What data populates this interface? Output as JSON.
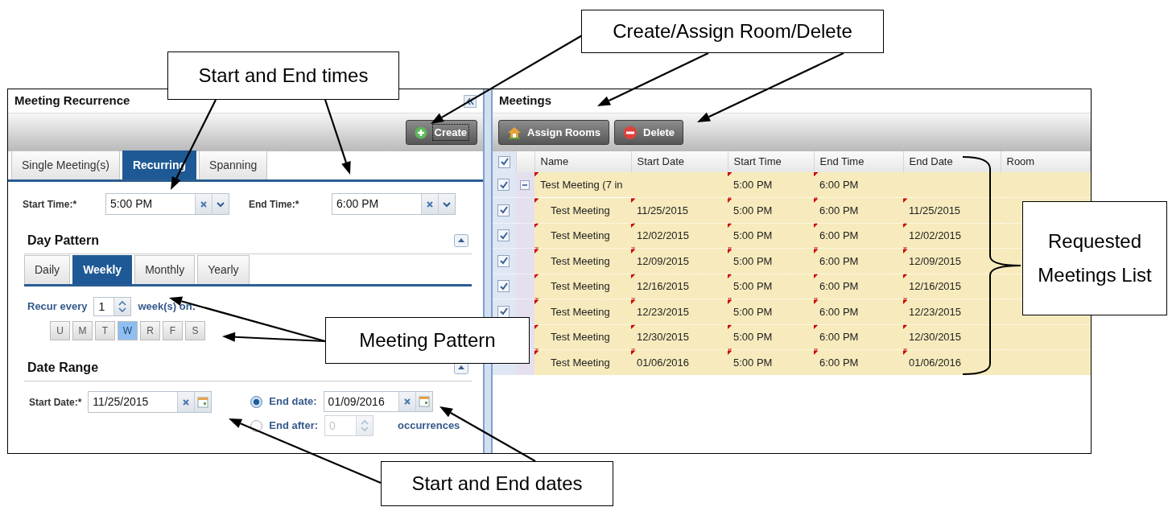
{
  "callouts": [
    {
      "text": "Create/Assign Room/Delete"
    },
    {
      "text": "Start and End times"
    },
    {
      "text": "Requested Meetings List"
    },
    {
      "text": "Meeting Pattern"
    },
    {
      "text": "Start and End dates"
    }
  ],
  "recurrence_panel": {
    "title": "Meeting Recurrence",
    "create_button": "Create",
    "tabs": [
      {
        "label": "Single Meeting(s)",
        "selected": false
      },
      {
        "label": "Recurring",
        "selected": true
      },
      {
        "label": "Spanning",
        "selected": false
      }
    ],
    "start_time": {
      "label": "Start Time:*",
      "value": "5:00 PM"
    },
    "end_time": {
      "label": "End Time:*",
      "value": "6:00 PM"
    },
    "day_pattern": {
      "title": "Day Pattern",
      "tabs": [
        {
          "label": "Daily",
          "selected": false
        },
        {
          "label": "Weekly",
          "selected": true
        },
        {
          "label": "Monthly",
          "selected": false
        },
        {
          "label": "Yearly",
          "selected": false
        }
      ],
      "recur_label": "Recur every",
      "interval": "1",
      "unit_label": "week(s) on:",
      "days": [
        {
          "label": "U",
          "selected": false
        },
        {
          "label": "M",
          "selected": false
        },
        {
          "label": "T",
          "selected": false
        },
        {
          "label": "W",
          "selected": true
        },
        {
          "label": "R",
          "selected": false
        },
        {
          "label": "F",
          "selected": false
        },
        {
          "label": "S",
          "selected": false
        }
      ]
    },
    "date_range": {
      "title": "Date Range",
      "start_date": {
        "label": "Start Date:*",
        "value": "11/25/2015"
      },
      "end_options": [
        {
          "label": "End date:",
          "value": "01/09/2016",
          "selected": true,
          "disabled": false
        },
        {
          "label": "End after:",
          "value": "0",
          "selected": false,
          "disabled": true
        }
      ],
      "occurrences_label": "occurrences"
    }
  },
  "meetings_panel": {
    "title": "Meetings",
    "buttons": [
      {
        "label": "Assign Rooms",
        "kind": "assign"
      },
      {
        "label": "Delete",
        "kind": "delete"
      }
    ],
    "header_checked": true,
    "columns": [
      "Name",
      "Start Date",
      "Start Time",
      "End Time",
      "End Date",
      "Room"
    ],
    "rows": [
      {
        "checked": true,
        "expanded": true,
        "name": "Test Meeting (7 in",
        "start_time": "5:00 PM",
        "end_time": "6:00 PM",
        "children": [
          {
            "checked": true,
            "name": "Test Meeting",
            "start_date": "11/25/2015",
            "start_time": "5:00 PM",
            "end_time": "6:00 PM",
            "end_date": "11/25/2015"
          },
          {
            "checked": true,
            "name": "Test Meeting",
            "start_date": "12/02/2015",
            "start_time": "5:00 PM",
            "end_time": "6:00 PM",
            "end_date": "12/02/2015"
          },
          {
            "checked": true,
            "name": "Test Meeting",
            "start_date": "12/09/2015",
            "start_time": "5:00 PM",
            "end_time": "6:00 PM",
            "end_date": "12/09/2015"
          },
          {
            "checked": true,
            "name": "Test Meeting",
            "start_date": "12/16/2015",
            "start_time": "5:00 PM",
            "end_time": "6:00 PM",
            "end_date": "12/16/2015"
          },
          {
            "checked": true,
            "name": "Test Meeting",
            "start_date": "12/23/2015",
            "start_time": "5:00 PM",
            "end_time": "6:00 PM",
            "end_date": "12/23/2015"
          },
          {
            "name": "Test Meeting",
            "start_date": "12/30/2015",
            "start_time": "5:00 PM",
            "end_time": "6:00 PM",
            "end_date": "12/30/2015"
          },
          {
            "name": "Test Meeting",
            "start_date": "01/06/2016",
            "start_time": "5:00 PM",
            "end_time": "6:00 PM",
            "end_date": "01/06/2016"
          }
        ]
      }
    ]
  }
}
